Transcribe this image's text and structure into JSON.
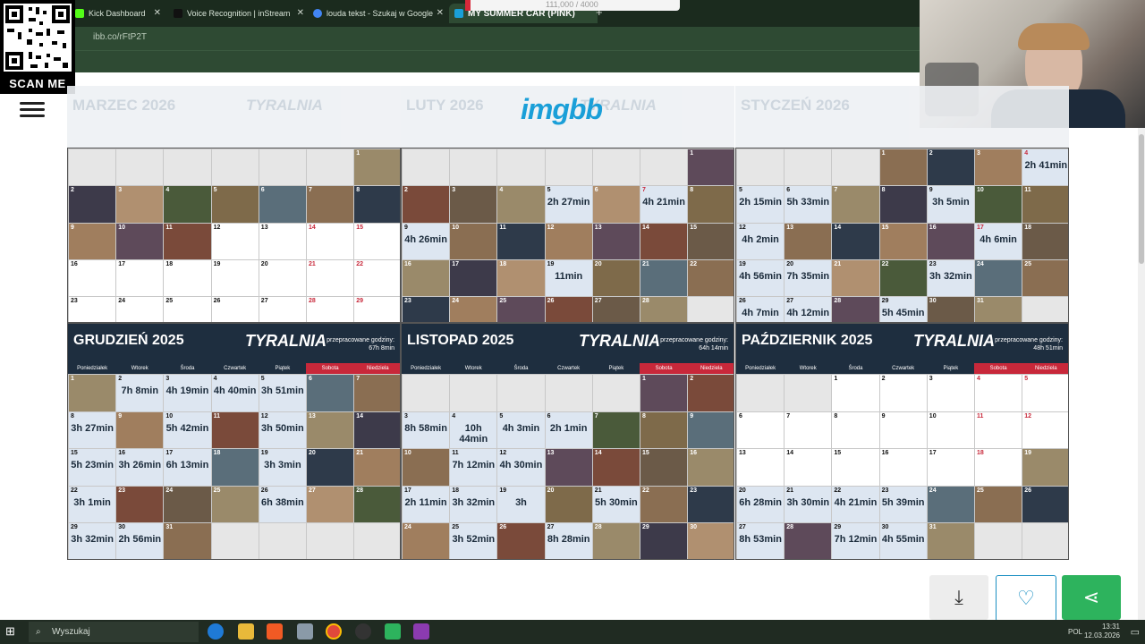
{
  "browser": {
    "tabs": [
      {
        "label": "Kick Dashboard",
        "fav": "#53fc18"
      },
      {
        "label": "Voice Recognition | inStream",
        "fav": "#111111"
      },
      {
        "label": "louda tekst - Szukaj w Google",
        "fav": "#4285f4"
      },
      {
        "label": "MY SUMMER CAR (PINK)",
        "fav": "#1a9fd8"
      }
    ],
    "tab_overlay_text": "111,000 / 4000",
    "url": "ibb.co/rFtP2T"
  },
  "qr": {
    "label": "SCAN ME"
  },
  "site": {
    "logo": "imgbb"
  },
  "faded_headers": [
    {
      "title": "MARZEC 2026",
      "brand": "TYRALNIA"
    },
    {
      "title": "LUTY 2026",
      "brand": "TYRALNIA"
    },
    {
      "title": "STYCZEŃ 2026",
      "brand": ""
    }
  ],
  "weekdays": [
    "Poniedziałek",
    "Wtorek",
    "Środa",
    "Czwartek",
    "Piątek",
    "Sobota",
    "Niedziela"
  ],
  "top_calendars": [
    {
      "name": "marzec",
      "offset": 6,
      "days": 31,
      "hours": {},
      "images": [
        1,
        2,
        3,
        4,
        5,
        6,
        7,
        8,
        9,
        10,
        11
      ]
    },
    {
      "name": "luty",
      "offset": 6,
      "days": 28,
      "hours": {
        "5": "2h 27min",
        "7": "4h 21min",
        "9": "4h 26min",
        "19": "11min"
      },
      "images": [
        1,
        2,
        3,
        4,
        6,
        8,
        10,
        11,
        12,
        13,
        14,
        15,
        16,
        17,
        18,
        20,
        21,
        22,
        23,
        24,
        25,
        26,
        27,
        28
      ]
    },
    {
      "name": "styczen",
      "offset": 3,
      "days": 31,
      "hours": {
        "4": "2h 41min",
        "5": "2h 15min",
        "6": "5h 33min",
        "9": "3h 5min",
        "12": "4h 2min",
        "17": "4h 6min",
        "19": "4h 56min",
        "20": "7h 35min",
        "23": "3h 32min",
        "26": "4h 7min",
        "27": "4h 12min",
        "29": "5h 45min"
      },
      "images": [
        1,
        2,
        3,
        7,
        8,
        10,
        11,
        13,
        14,
        15,
        16,
        18,
        21,
        22,
        24,
        25,
        28,
        30,
        31
      ]
    }
  ],
  "bottom_calendars": [
    {
      "title": "GRUDZIEŃ 2025",
      "brand": "TYRALNIA",
      "hours_label": "przepracowane godziny:",
      "hours_total": "67h 8min",
      "offset": 0,
      "days": 31,
      "hours": {
        "2": "7h 8min",
        "3": "4h 19min",
        "4": "4h 40min",
        "5": "3h 51min",
        "8": "3h 27min",
        "10": "5h 42min",
        "12": "3h 50min",
        "15": "5h 23min",
        "16": "3h 26min",
        "17": "6h 13min",
        "19": "3h 3min",
        "22": "3h 1min",
        "26": "6h 38min",
        "29": "3h 32min",
        "30": "2h 56min"
      },
      "images": [
        1,
        6,
        7,
        9,
        11,
        13,
        14,
        18,
        20,
        21,
        23,
        24,
        25,
        27,
        28,
        31
      ]
    },
    {
      "title": "LISTOPAD 2025",
      "brand": "TYRALNIA",
      "hours_label": "przepracowane godziny:",
      "hours_total": "64h 14min",
      "offset": 5,
      "days": 30,
      "hours": {
        "3": "8h 58min",
        "4": "10h 44min",
        "5": "4h 3min",
        "6": "2h 1min",
        "11": "7h 12min",
        "12": "4h 30min",
        "17": "2h 11min",
        "18": "3h 32min",
        "19": "3h",
        "21": "5h 30min",
        "25": "3h 52min",
        "27": "8h 28min"
      },
      "images": [
        1,
        2,
        7,
        8,
        9,
        10,
        13,
        14,
        15,
        16,
        20,
        22,
        23,
        24,
        26,
        28,
        29,
        30
      ]
    },
    {
      "title": "PAŹDZIERNIK 2025",
      "brand": "TYRALNIA",
      "hours_label": "przepracowane godziny:",
      "hours_total": "48h 51min",
      "offset": 2,
      "days": 31,
      "hours": {
        "20": "6h 28min",
        "21": "3h 30min",
        "22": "4h 21min",
        "23": "5h 39min",
        "27": "8h 53min",
        "29": "7h 12min",
        "30": "4h 55min"
      },
      "images": [
        19,
        24,
        25,
        26,
        28,
        31
      ]
    }
  ],
  "actions": {
    "download": "⤓",
    "like": "♡",
    "share": "⋖"
  },
  "taskbar": {
    "search_placeholder": "Wyszukaj",
    "lang": "POL",
    "time": "13:31",
    "date": "12.03.2026"
  }
}
